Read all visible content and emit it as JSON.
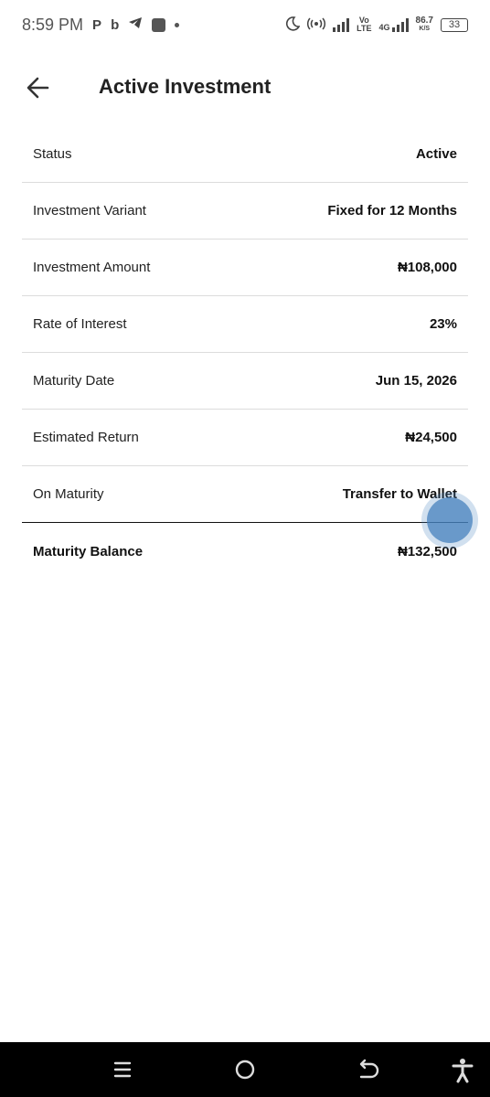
{
  "status_bar": {
    "time": "8:59 PM",
    "icons": [
      "p-icon",
      "b-icon",
      "telegram-icon",
      "app-square-icon",
      "dot-icon",
      "moon-icon",
      "hotspot-icon",
      "signal-icon",
      "volte-icon",
      "4g-signal-icon",
      "battery-icon"
    ],
    "volte_top": "Vo",
    "volte_bottom": "LTE",
    "network_type": "4G",
    "speed_value": "86.7",
    "speed_unit": "K/S",
    "battery": "33"
  },
  "header": {
    "title": "Active Investment"
  },
  "details": [
    {
      "label": "Status",
      "value": "Active"
    },
    {
      "label": "Investment Variant",
      "value": "Fixed for 12 Months"
    },
    {
      "label": "Investment Amount",
      "value": "₦108,000"
    },
    {
      "label": "Rate of Interest",
      "value": "23%"
    },
    {
      "label": "Maturity Date",
      "value": "Jun 15, 2026"
    },
    {
      "label": "Estimated Return",
      "value": "₦24,500"
    },
    {
      "label": "On Maturity",
      "value": "Transfer to Wallet"
    }
  ],
  "total": {
    "label": "Maturity Balance",
    "value": "₦132,500"
  },
  "nav_bar": {
    "icons": [
      "recents-icon",
      "home-icon",
      "back-nav-icon",
      "accessibility-icon"
    ]
  },
  "colors": {
    "background": "#ffffff",
    "text": "#111111",
    "divider": "#dcdcdc",
    "nav_bar": "#000000",
    "touch_indicator": "#4682be"
  }
}
